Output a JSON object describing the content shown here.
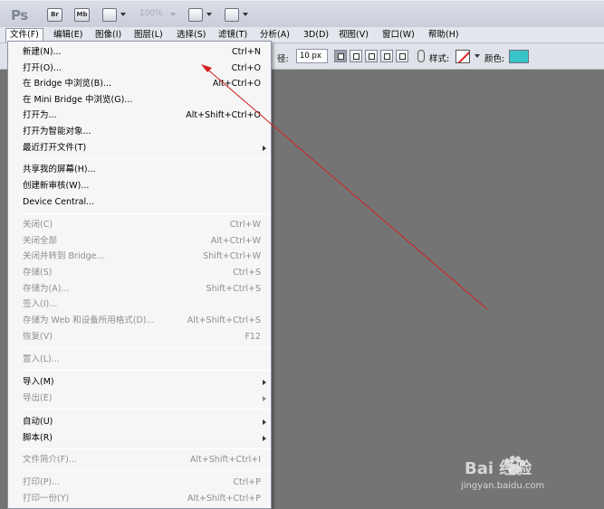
{
  "app": {
    "logo": "Ps",
    "bridge_btn": "Br",
    "minibridge_btn": "Mb",
    "zoom": "100%"
  },
  "menubar": [
    {
      "label": "文件(F)",
      "active": true
    },
    {
      "label": "编辑(E)"
    },
    {
      "label": "图像(I)"
    },
    {
      "label": "图层(L)"
    },
    {
      "label": "选择(S)"
    },
    {
      "label": "滤镜(T)"
    },
    {
      "label": "分析(A)"
    },
    {
      "label": "3D(D)"
    },
    {
      "label": "视图(V)"
    },
    {
      "label": "窗口(W)"
    },
    {
      "label": "帮助(H)"
    }
  ],
  "options": {
    "radius_label": "径:",
    "radius_value": "10 px",
    "style_label": "样式:",
    "color_label": "颜色:",
    "color_value": "#38c4c8"
  },
  "file_menu": [
    {
      "label": "新建(N)...",
      "shortcut": "Ctrl+N",
      "enabled": true
    },
    {
      "label": "打开(O)...",
      "shortcut": "Ctrl+O",
      "enabled": true
    },
    {
      "label": "在 Bridge 中浏览(B)...",
      "shortcut": "Alt+Ctrl+O",
      "enabled": true
    },
    {
      "label": "在 Mini Bridge 中浏览(G)...",
      "shortcut": "",
      "enabled": true
    },
    {
      "label": "打开为...",
      "shortcut": "Alt+Shift+Ctrl+O",
      "enabled": true
    },
    {
      "label": "打开为智能对象...",
      "shortcut": "",
      "enabled": true
    },
    {
      "label": "最近打开文件(T)",
      "shortcut": "",
      "enabled": true,
      "submenu": true
    },
    {
      "label": "共享我的屏幕(H)...",
      "shortcut": "",
      "enabled": true
    },
    {
      "label": "创建新审核(W)...",
      "shortcut": "",
      "enabled": true
    },
    {
      "label": "Device Central...",
      "shortcut": "",
      "enabled": true
    },
    {
      "label": "关闭(C)",
      "shortcut": "Ctrl+W",
      "enabled": false
    },
    {
      "label": "关闭全部",
      "shortcut": "Alt+Ctrl+W",
      "enabled": false
    },
    {
      "label": "关闭并转到 Bridge...",
      "shortcut": "Shift+Ctrl+W",
      "enabled": false
    },
    {
      "label": "存储(S)",
      "shortcut": "Ctrl+S",
      "enabled": false
    },
    {
      "label": "存储为(A)...",
      "shortcut": "Shift+Ctrl+S",
      "enabled": false
    },
    {
      "label": "签入(I)...",
      "shortcut": "",
      "enabled": false
    },
    {
      "label": "存储为 Web 和设备所用格式(D)...",
      "shortcut": "Alt+Shift+Ctrl+S",
      "enabled": false
    },
    {
      "label": "恢复(V)",
      "shortcut": "F12",
      "enabled": false
    },
    {
      "label": "置入(L)...",
      "shortcut": "",
      "enabled": false
    },
    {
      "label": "导入(M)",
      "shortcut": "",
      "enabled": true,
      "submenu": true
    },
    {
      "label": "导出(E)",
      "shortcut": "",
      "enabled": false,
      "submenu": true
    },
    {
      "label": "自动(U)",
      "shortcut": "",
      "enabled": true,
      "submenu": true
    },
    {
      "label": "脚本(R)",
      "shortcut": "",
      "enabled": true,
      "submenu": true
    },
    {
      "label": "文件简介(F)...",
      "shortcut": "Alt+Shift+Ctrl+I",
      "enabled": false
    },
    {
      "label": "打印(P)...",
      "shortcut": "Ctrl+P",
      "enabled": false
    },
    {
      "label": "打印一份(Y)",
      "shortcut": "Alt+Shift+Ctrl+P",
      "enabled": false
    }
  ],
  "watermark": {
    "brand": "Bai  经验",
    "url": "jingyan.baidu.com"
  }
}
